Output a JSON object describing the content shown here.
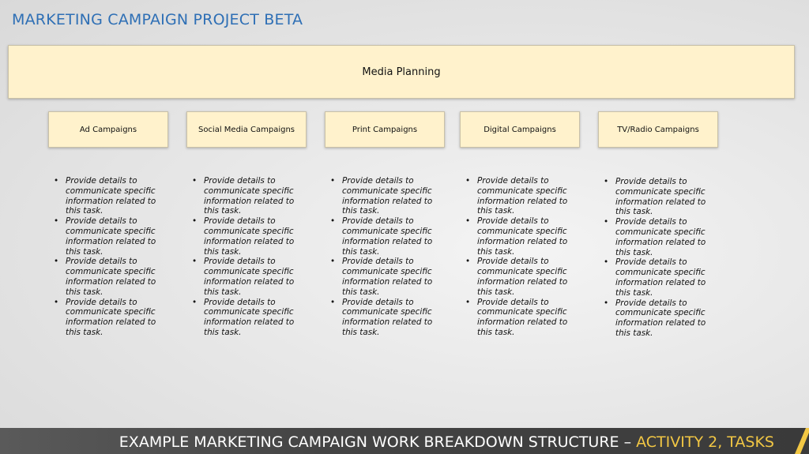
{
  "title": "MARKETING CAMPAIGN PROJECT BETA",
  "root": {
    "label": "Media Planning"
  },
  "children": [
    {
      "label": "Ad Campaigns",
      "details": [
        "Provide details to communicate specific information related to this task.",
        "Provide details to communicate specific information related to this task.",
        "Provide details to communicate specific information related to this task.",
        "Provide details to communicate specific information related to this task."
      ]
    },
    {
      "label": "Social Media Campaigns",
      "details": [
        "Provide details to communicate specific information related to this task.",
        "Provide details to communicate specific information related to this task.",
        "Provide details to communicate specific information related to this task.",
        "Provide details to communicate specific information related to this task."
      ]
    },
    {
      "label": "Print Campaigns",
      "details": [
        "Provide details to communicate specific information related to this task.",
        "Provide details to communicate specific information related to this task.",
        "Provide details to communicate specific information related to this task.",
        "Provide details to communicate specific information related to this task."
      ]
    },
    {
      "label": "Digital Campaigns",
      "details": [
        "Provide details to communicate specific information related to this task.",
        "Provide details to communicate specific information related to this task.",
        "Provide details to communicate specific information related to this task.",
        "Provide details to communicate specific information related to this task."
      ]
    },
    {
      "label": "TV/Radio Campaigns",
      "details": [
        "Provide details to communicate specific information related to this task.",
        "Provide details to communicate specific information related to this task.",
        "Provide details to communicate specific information related to this task.",
        "Provide details to communicate specific information related to this task."
      ]
    }
  ],
  "footer": {
    "main": "EXAMPLE MARKETING CAMPAIGN WORK BREAKDOWN STRUCTURE – ",
    "accent": "ACTIVITY 2, TASKS"
  },
  "colors": {
    "title": "#2e6fb5",
    "box_fill": "#fff2cc",
    "footer_bg": "#444444",
    "footer_accent": "#f2c744"
  }
}
